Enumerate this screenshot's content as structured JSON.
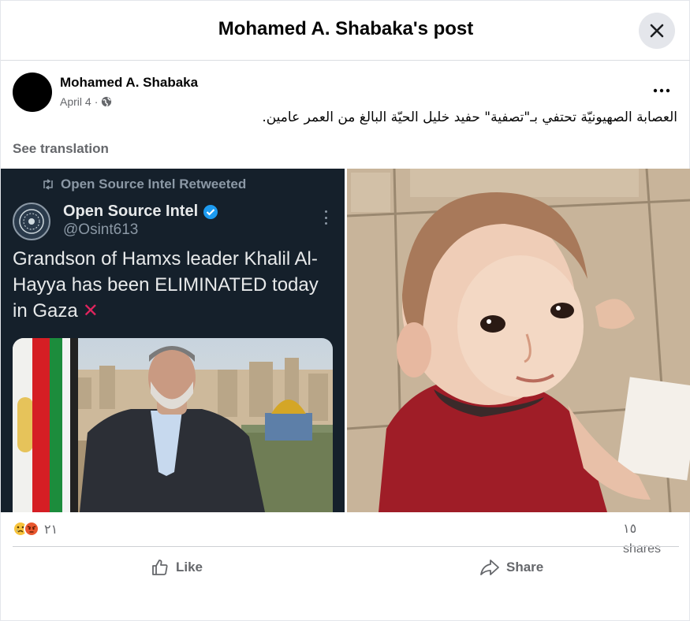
{
  "dialog": {
    "title": "Mohamed A. Shabaka's post",
    "close_icon": "close-icon"
  },
  "post": {
    "author": "Mohamed A. Shabaka",
    "date": "April 4",
    "separator": "·",
    "privacy_icon": "globe-icon",
    "more_icon": "more-horizontal-icon",
    "text": "العصابة الصهيونيّة تحتفي بـ\"تصفية\" حفيد خليل الحيّة البالغ من العمر عامين.",
    "see_translation": "See translation"
  },
  "tweet": {
    "retweet_line": "Open Source Intel Retweeted",
    "name": "Open Source Intel",
    "handle": "@Osint613",
    "text": "Grandson of Hamxs leader Khalil Al-Hayya has been ELIMINATED today in Gaza",
    "emoji": "✕",
    "verified_icon": "verified-badge-icon"
  },
  "stats": {
    "reaction_icons": [
      "sad-reaction-icon",
      "angry-reaction-icon"
    ],
    "reaction_count": "٢١",
    "shares_count": "١٥",
    "shares_label": "shares"
  },
  "actions": {
    "like_label": "Like",
    "share_label": "Share"
  },
  "colors": {
    "facebook_gray": "#65676b",
    "tweet_bg": "#15202b",
    "verified_blue": "#1d9bf0"
  }
}
